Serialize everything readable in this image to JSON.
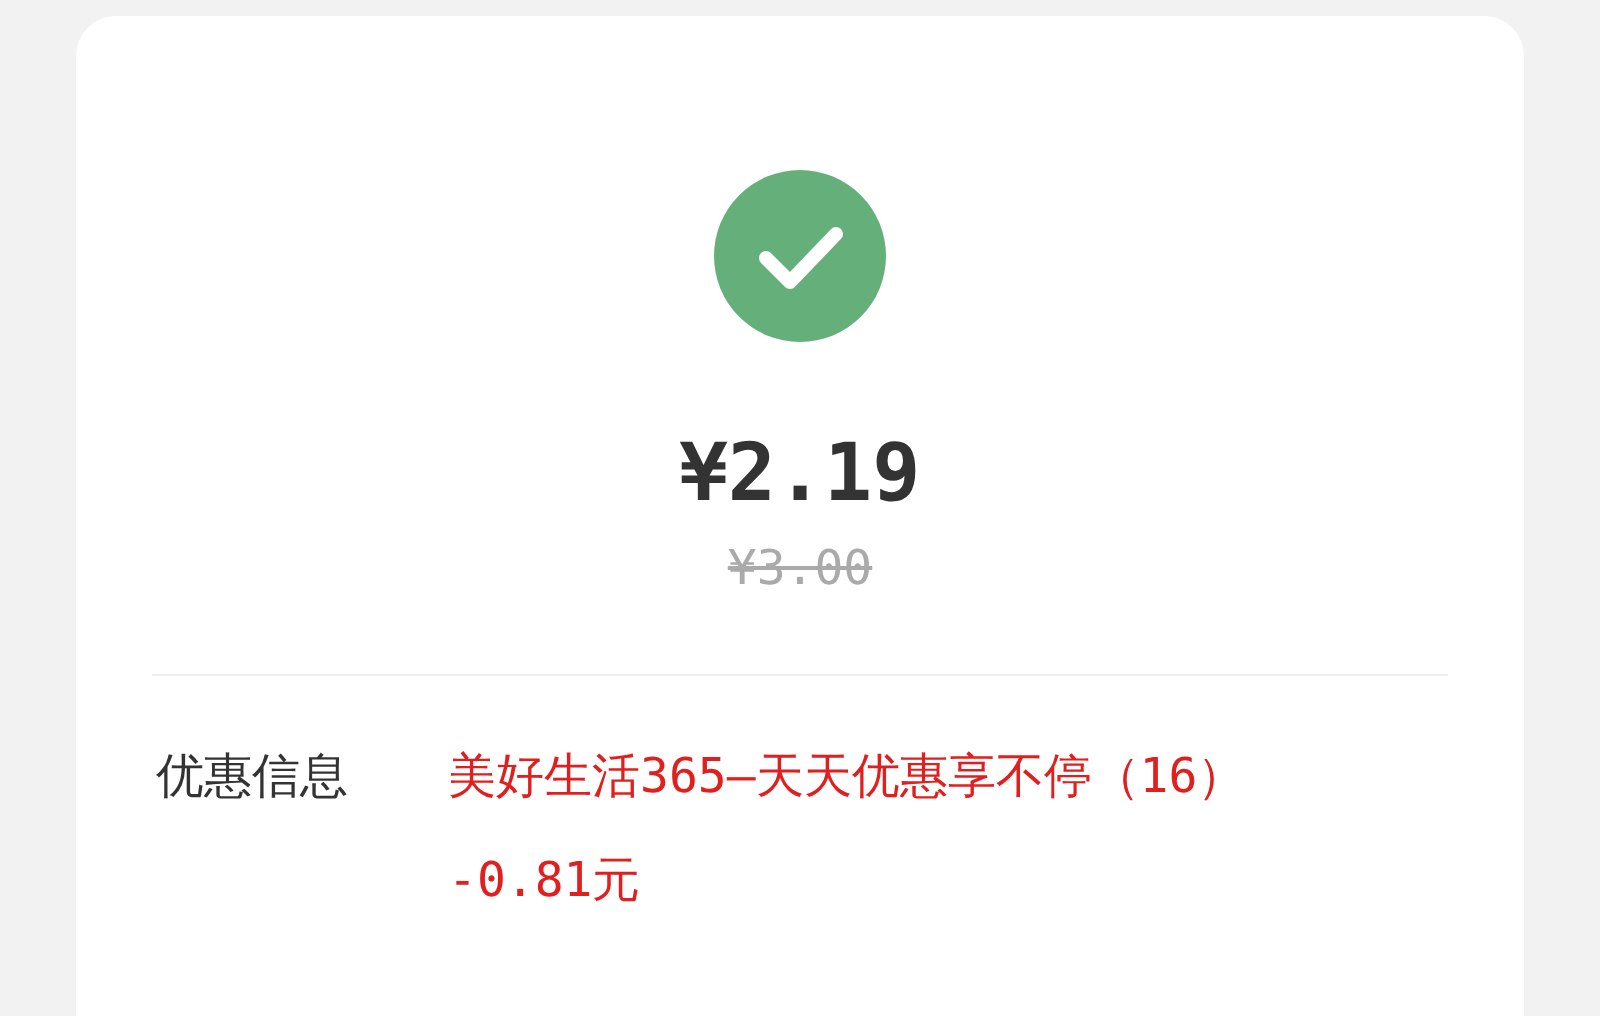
{
  "payment": {
    "icon": {
      "kind": "success"
    },
    "price": "¥2.19",
    "original_price": "¥3.00"
  },
  "details": [
    {
      "label": "优惠信息",
      "lines": [
        "美好生活365–天天优惠享不停（16）",
        "-0.81元"
      ]
    }
  ]
}
